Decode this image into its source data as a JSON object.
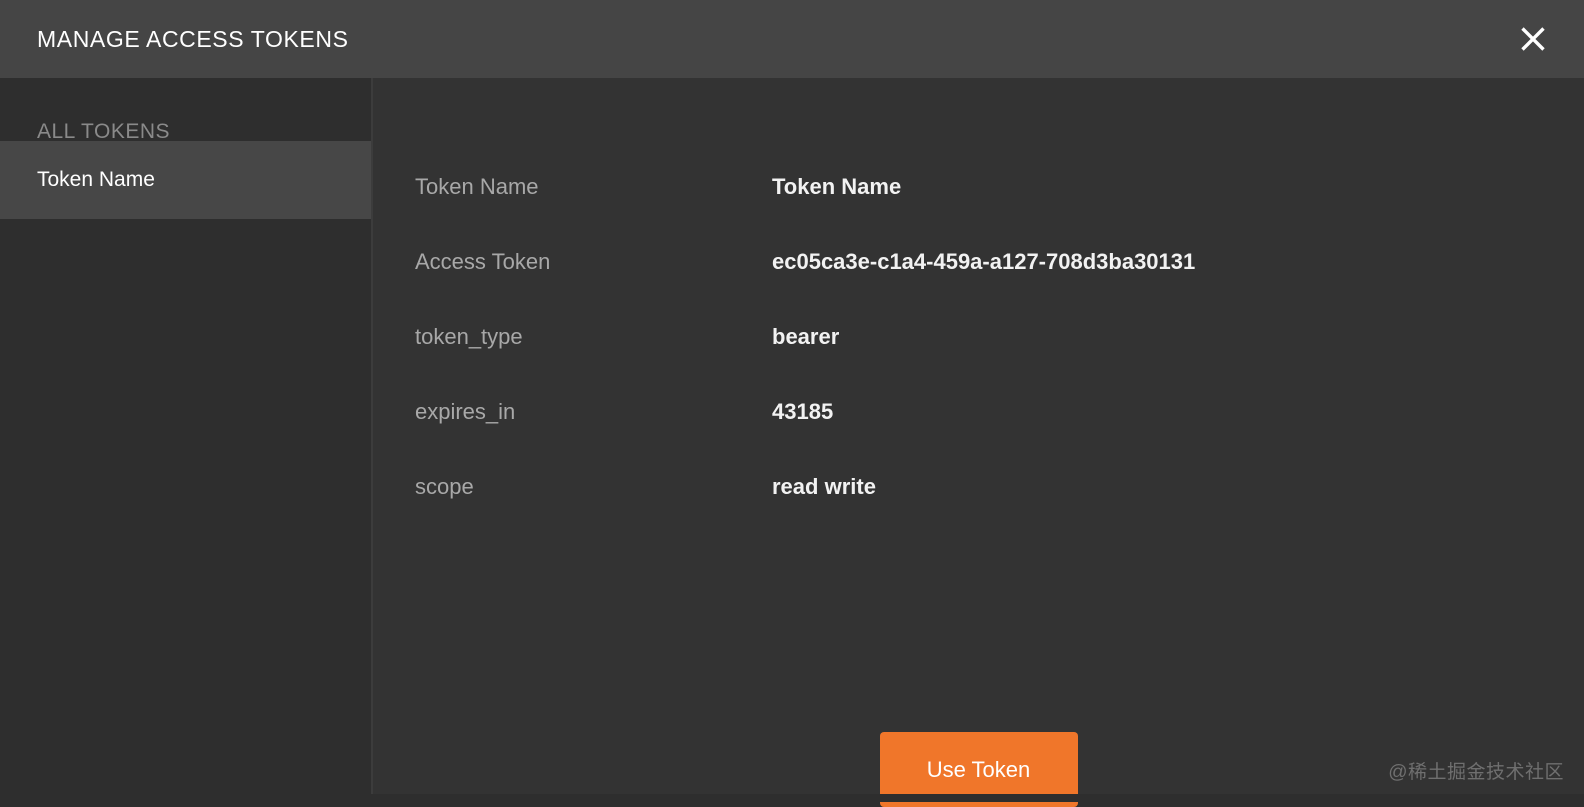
{
  "header": {
    "title": "MANAGE ACCESS TOKENS",
    "close_icon": "close-icon"
  },
  "sidebar": {
    "heading": "ALL TOKENS",
    "items": [
      {
        "label": "Token Name",
        "selected": true
      }
    ]
  },
  "main": {
    "fields": [
      {
        "label": "Token Name",
        "value": "Token Name"
      },
      {
        "label": "Access Token",
        "value": "ec05ca3e-c1a4-459a-a127-708d3ba30131"
      },
      {
        "label": "token_type",
        "value": "bearer"
      },
      {
        "label": "expires_in",
        "value": "43185"
      },
      {
        "label": "scope",
        "value": "read write"
      }
    ],
    "primary_action": "Use Token"
  },
  "watermark": "@稀土掘金技术社区",
  "colors": {
    "header_bg": "#454545",
    "sidebar_bg": "#2e2e2e",
    "sidebar_selected_bg": "#474747",
    "main_bg": "#333333",
    "accent_orange": "#f0762a",
    "label_text": "#a8a8a8",
    "value_text": "#f2f2f2",
    "muted_text": "#8a8a8a"
  }
}
